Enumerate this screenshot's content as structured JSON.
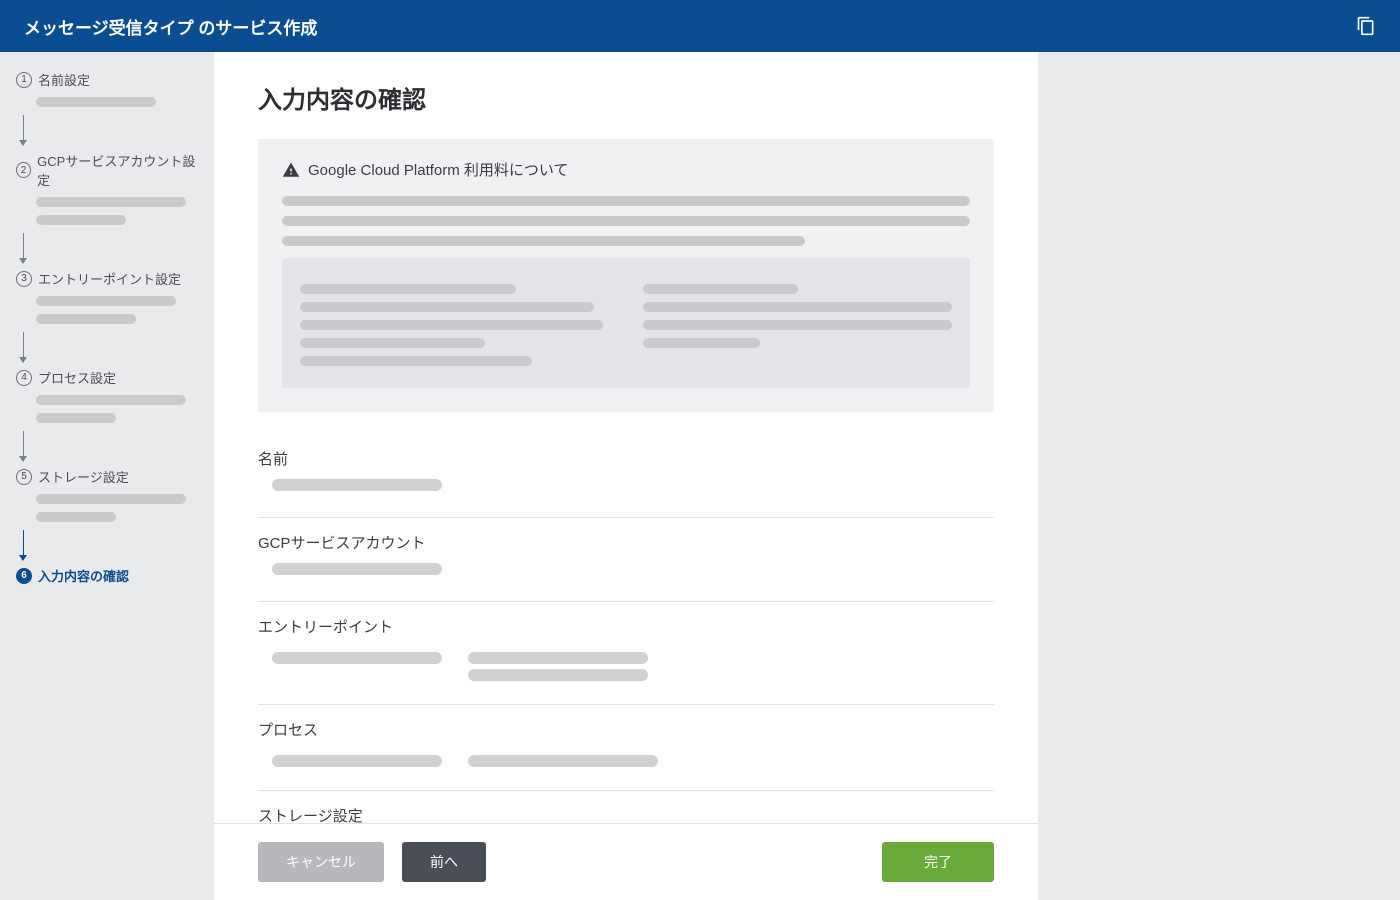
{
  "header": {
    "title": "メッセージ受信タイプ のサービス作成"
  },
  "sidebar": {
    "steps": [
      {
        "num": "1",
        "label": "名前設定"
      },
      {
        "num": "2",
        "label": "GCPサービスアカウント設定"
      },
      {
        "num": "3",
        "label": "エントリーポイント設定"
      },
      {
        "num": "4",
        "label": "プロセス設定"
      },
      {
        "num": "5",
        "label": "ストレージ設定"
      },
      {
        "num": "6",
        "label": "入力内容の確認"
      }
    ]
  },
  "main": {
    "title": "入力内容の確認",
    "notice_title": "Google Cloud Platform 利用料について",
    "sections": [
      {
        "label": "名前"
      },
      {
        "label": "GCPサービスアカウント"
      },
      {
        "label": "エントリーポイント"
      },
      {
        "label": "プロセス"
      },
      {
        "label": "ストレージ設定"
      }
    ]
  },
  "footer": {
    "cancel": "キャンセル",
    "prev": "前へ",
    "done": "完了"
  }
}
